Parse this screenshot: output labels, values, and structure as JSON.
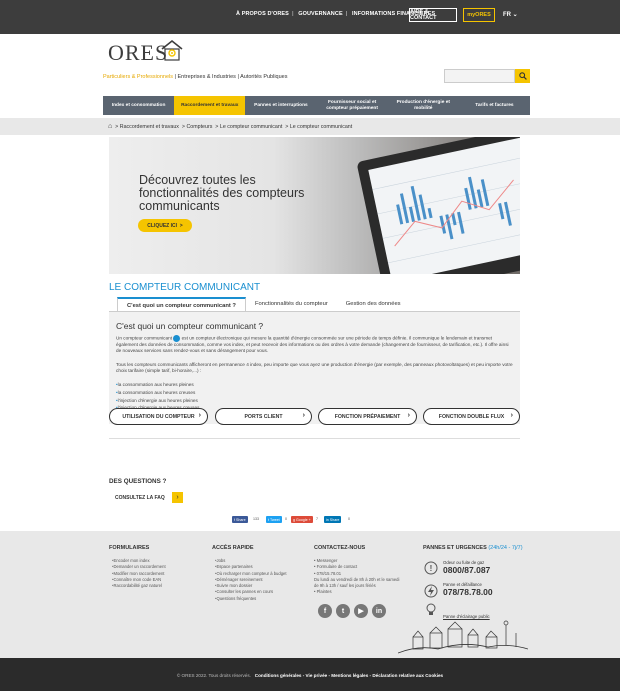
{
  "topnav": {
    "items": [
      "À PROPOS D'ORES",
      "GOUVERNANCE",
      "INFORMATIONS FINANCIÈRES"
    ],
    "aide_label": "AIDE & CONTACT",
    "myores_label": "myORES",
    "lang": "FR"
  },
  "brand": {
    "name": "ORES"
  },
  "segments": {
    "active": "Particuliers & Professionnels",
    "items": [
      "Entreprises & Industries",
      "Autorités Publiques"
    ]
  },
  "mainnav": [
    "Index et consommation",
    "Raccordement et travaux",
    "Pannes et interruptions",
    "Fournisseur social et compteur prépaiement",
    "Production d'énergie et mobilité",
    "Tarifs et factures"
  ],
  "breadcrumb": [
    "Raccordement et travaux",
    "Compteurs",
    "Le compteur communicant",
    "Le compteur communicant"
  ],
  "hero": {
    "title": "Découvrez toutes les fonctionnalités des compteurs communicants",
    "cta": "CLIQUEZ ICI"
  },
  "section_title": "LE COMPTEUR COMMUNICANT",
  "tabs": [
    "C'est quoi un compteur communicant ?",
    "Fonctionnalités du compteur",
    "Gestion des données"
  ],
  "content": {
    "title": "C'est quoi un compteur communicant ?",
    "p1a": "Un compteur communicant",
    "p1b": "est un compteur électronique qui mesure la quantité d'énergie consommée sur une période de temps définie. Il communique le lendemain et transmet également des données de consommation, comme vos index, et peut recevoir des informations ou des ordres à votre demande (changement de fournisseur, de tarification, etc.). Il offre ainsi de nouveaux services sans rendez-vous et sans dérangement pour vous.",
    "p2": "Tous les compteurs communicants afficheront en permanence 4 index, peu importe que vous ayez une production d'énergie (par exemple, des panneaux photovoltaïques) et peu importe votre choix tarifaire (simple tarif, bi-horaire,...) :",
    "list": [
      "la consommation aux heures pleines",
      "la consommation aux heures creuses",
      "l'injection d'énergie aux heures pleines",
      "l'injection d'énergie aux heures creuses"
    ]
  },
  "pills": [
    "UTILISATION DU COMPTEUR",
    "PORTS CLIENT",
    "FONCTION PRÉPAIEMENT",
    "FONCTION DOUBLE FLUX"
  ],
  "questions": {
    "title": "DES QUESTIONS ?",
    "faq": "CONSULTEZ LA FAQ"
  },
  "share": {
    "facebook": "Share",
    "facebook_count": "133",
    "twitter": "Tweet",
    "twitter_count": "0",
    "google": "Google +",
    "google_count": "7",
    "linkedin": "Share",
    "linkedin_count": "0"
  },
  "footer": {
    "formulaires_title": "FORMULAIRES",
    "formulaires": [
      "Encoder mon index",
      "Demander un raccordement",
      "Modifier mon raccordement",
      "Connaître mon code EAN",
      "Raccordabilité gaz naturel"
    ],
    "acces_title": "ACCÈS RAPIDE",
    "acces": [
      "Jobs",
      "Espace partenaires",
      "Où recharger mon compteur à budget",
      "Déménager sereinement",
      "Suivre mon dossier",
      "Consulter les pannes en cours",
      "Questions fréquentes"
    ],
    "contact_title": "CONTACTEZ-NOUS",
    "contact": [
      "Messenger",
      "Formulaire de contact",
      "078/15.78.01",
      "Du lundi au vendredi de 8h à 20h et le samedi",
      "de 9h à 13h / sauf les jours fériés",
      "Plaintes"
    ],
    "urgences_title": "PANNES ET URGENCES",
    "urgences_hours": "(24h/24 - 7j/7)",
    "gas_label": "Odeur ou fuite de gaz",
    "gas_number": "0800/87.087",
    "elec_label": "Panne et défaillance",
    "elec_number": "078/78.78.00",
    "public_light": "Panne d'éclairage public"
  },
  "copyright": {
    "text": "© ORES 2022. Tous droits réservés.",
    "links": "Conditions générales - Vie privée - Mentions légales - Déclaration relative aux Cookies"
  },
  "colors": {
    "accent": "#f5c400",
    "blue": "#1a8fd0",
    "dark": "#3d3d3d",
    "nav": "#5a6470"
  }
}
